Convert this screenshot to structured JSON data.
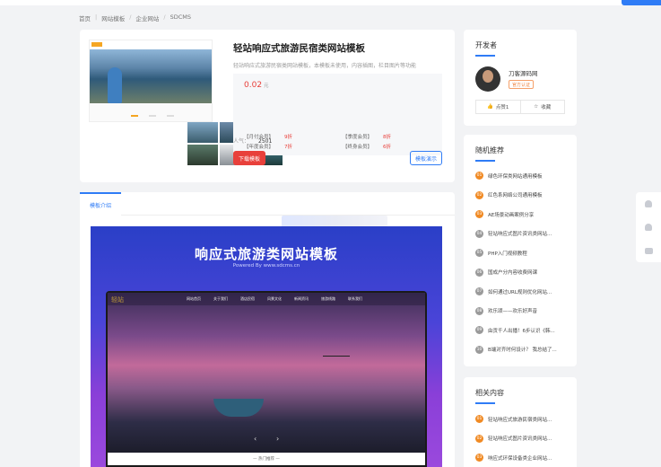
{
  "breadcrumb": [
    "首页",
    "网站模板",
    "企业网站",
    "SDCMS"
  ],
  "product": {
    "title": "轻站响应式旅游民宿类网站模板",
    "desc": "轻站响应式旅游民宿类网站模板，本模板未使用，内容插图，栏目图片等功能",
    "price": "0.02",
    "price_unit": "元",
    "vip": [
      {
        "label": "【月付会员】",
        "value": "9折"
      },
      {
        "label": "【季度会员】",
        "value": "8折"
      },
      {
        "label": "【年度会员】",
        "value": "7折"
      },
      {
        "label": "【终身会员】",
        "value": "6折"
      }
    ],
    "popularity_label": "人气：",
    "popularity_value": "2501",
    "download_label": "下载模板",
    "demo_label": "模板演示"
  },
  "detail": {
    "tab_label": "模板介绍",
    "banner_title": "响应式旅游类网站模板",
    "banner_sub": "Powered By www.sdcms.cn",
    "screen_logo": "轻站",
    "screen_nav": [
      "网站首页",
      "关于我们",
      "酒店民宿",
      "风景文化",
      "新闻资讯",
      "旅游线路",
      "联系我们"
    ],
    "screen_footer": "— 热门推荐 —"
  },
  "developer": {
    "heading": "开发者",
    "name": "刀客源码网",
    "badge": "官方认证",
    "like_label": "点赞1",
    "fav_label": "收藏"
  },
  "random": {
    "heading": "随机推荐",
    "items": [
      {
        "n": "01",
        "text": "绿色环保类网站通用模板"
      },
      {
        "n": "02",
        "text": "红色系网络公司通用模板"
      },
      {
        "n": "03",
        "text": "AE场景动画案例分享"
      },
      {
        "n": "04",
        "text": "轻站响应式图片资讯类网站..."
      },
      {
        "n": "05",
        "text": "PHP入门视频教程"
      },
      {
        "n": "06",
        "text": "国成户分内容收费网课"
      },
      {
        "n": "07",
        "text": "如何通过URL规则优化网站..."
      },
      {
        "n": "08",
        "text": "欢乐颂——欢乐好声音"
      },
      {
        "n": "09",
        "text": "由贡千人出播！6步认识《韩..."
      },
      {
        "n": "10",
        "text": "B端对齐时何设计？ 我总结了..."
      }
    ]
  },
  "related": {
    "heading": "相关内容",
    "items": [
      {
        "n": "01",
        "text": "轻站响应式旅游民宿类网站..."
      },
      {
        "n": "02",
        "text": "轻站响应式图片资讯类网站..."
      },
      {
        "n": "03",
        "text": "响应式环保设备类企业网站..."
      }
    ]
  },
  "colors": {
    "accent": "#2f7cf6",
    "danger": "#e8403b",
    "hot": "#f08a24"
  }
}
